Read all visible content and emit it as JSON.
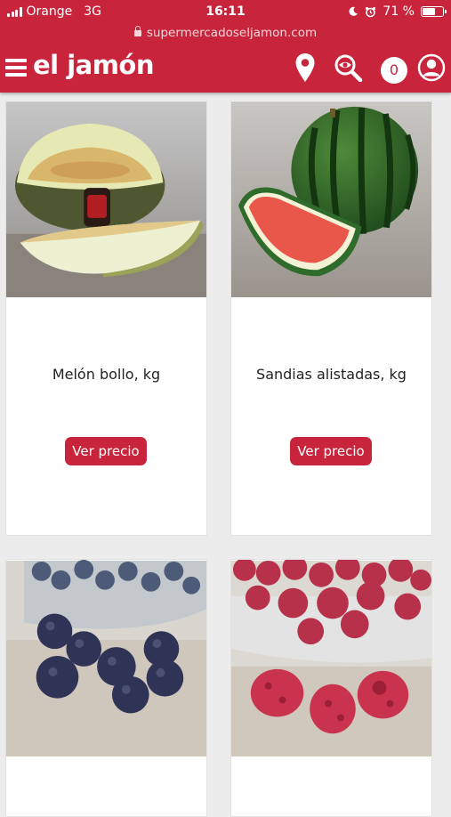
{
  "status_bar": {
    "carrier": "Orange",
    "network": "3G",
    "time": "16:11",
    "battery": "71 %",
    "battery_level": 0.71
  },
  "url_bar": {
    "url": "supermercadoseljamon.com"
  },
  "header": {
    "logo": "el jamón",
    "cart_count": "0",
    "icons": [
      "menu-icon",
      "location-pin-icon",
      "search-icon",
      "user-icon"
    ]
  },
  "products": [
    {
      "name": "Melón bollo, kg",
      "button": "Ver precio"
    },
    {
      "name": "Sandias alistadas, kg",
      "button": "Ver precio"
    },
    {
      "name": "",
      "button": ""
    },
    {
      "name": "",
      "button": ""
    }
  ],
  "colors": {
    "brand": "#c8243b",
    "background": "#ececec"
  }
}
